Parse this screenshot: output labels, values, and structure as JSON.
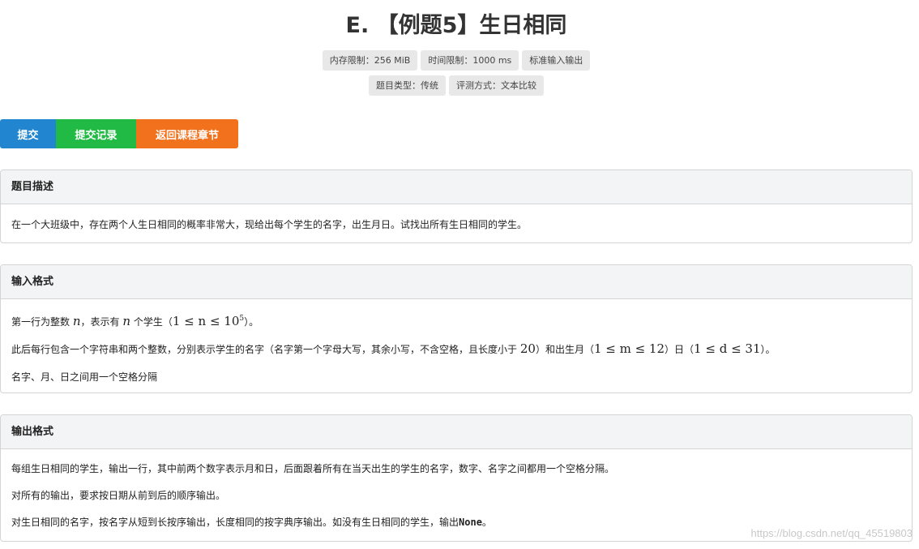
{
  "problem": {
    "title": "E. 【例题5】生日相同",
    "meta_row1": [
      "内存限制：256 MiB",
      "时间限制：1000 ms",
      "标准输入输出"
    ],
    "meta_row2": [
      "题目类型：传统",
      "评测方式：文本比较"
    ]
  },
  "actions": {
    "submit": "提交",
    "records": "提交记录",
    "back": "返回课程章节"
  },
  "colors": {
    "submit": "#2185d0",
    "records": "#21ba45",
    "back": "#f2711c"
  },
  "description": {
    "heading": "题目描述",
    "text": "在一个大班级中，存在两个人生日相同的概率非常大，现给出每个学生的名字，出生月日。试找出所有生日相同的学生。"
  },
  "input": {
    "heading": "输入格式",
    "line1": {
      "a": "第一行为整数",
      "var_n": "n",
      "b": "，表示有",
      "c": "个学生（",
      "math_range": "1 ≤ n ≤ 10",
      "exp": "5",
      "d": "）。"
    },
    "line2": {
      "a": "此后每行包含一个字符串和两个整数，分别表示学生的名字（名字第一个字母大写，其余小写，不含空格，且长度小于",
      "len": "20",
      "b": "）和出生月（",
      "math_month": "1 ≤ m ≤ 12",
      "c": "）日（",
      "math_day": "1 ≤ d ≤ 31",
      "d": "）。"
    },
    "line3": "名字、月、日之间用一个空格分隔"
  },
  "output": {
    "heading": "输出格式",
    "line1": "每组生日相同的学生，输出一行，其中前两个数字表示月和日，后面跟着所有在当天出生的学生的名字，数字、名字之间都用一个空格分隔。",
    "line2": "对所有的输出，要求按日期从前到后的顺序输出。",
    "line3_a": "对生日相同的名字，按名字从短到长按序输出，长度相同的按字典序输出。如没有生日相同的学生，输出",
    "line3_code": "None",
    "line3_b": "。"
  },
  "watermark": "https://blog.csdn.net/qq_45519803"
}
